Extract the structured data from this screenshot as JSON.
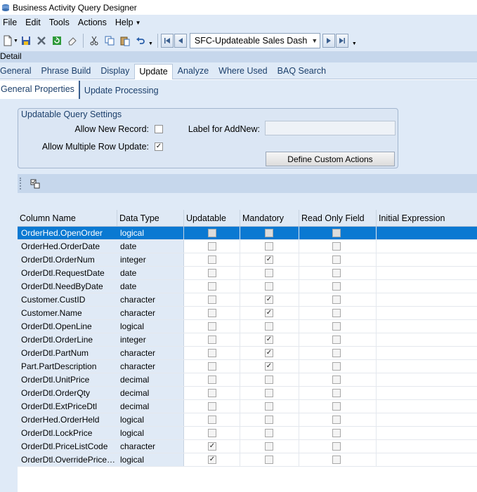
{
  "window": {
    "title": "Business Activity Query Designer"
  },
  "menu": [
    {
      "label": "File"
    },
    {
      "label": "Edit"
    },
    {
      "label": "Tools"
    },
    {
      "label": "Actions"
    },
    {
      "label": "Help"
    }
  ],
  "toolbar": {
    "query_select": "SFC-Updateable Sales Dash"
  },
  "section": {
    "label": "Detail"
  },
  "tabs": [
    {
      "label": "General"
    },
    {
      "label": "Phrase Build"
    },
    {
      "label": "Display"
    },
    {
      "label": "Update"
    },
    {
      "label": "Analyze"
    },
    {
      "label": "Where Used"
    },
    {
      "label": "BAQ Search"
    }
  ],
  "subtabs": [
    {
      "label": "General Properties"
    },
    {
      "label": "Update  Processing"
    }
  ],
  "settings": {
    "group_title": "Updatable Query Settings",
    "allow_new_record_label": "Allow New Record:",
    "allow_new_record_checked": "",
    "label_for_addnew_label": "Label for AddNew:",
    "label_for_addnew_value": "",
    "allow_multi_update_label": "Allow Multiple Row Update:",
    "allow_multi_update_checked": "✓",
    "define_actions_label": "Define Custom Actions"
  },
  "grid": {
    "headers": [
      "Column Name",
      "Data Type",
      "Updatable",
      "Mandatory",
      "Read Only Field",
      "Initial Expression"
    ],
    "rows": [
      {
        "name": "OrderHed.OpenOrder",
        "type": "logical",
        "updatable": "",
        "mandatory": "",
        "readonly": "",
        "initial": ""
      },
      {
        "name": "OrderHed.OrderDate",
        "type": "date",
        "updatable": "",
        "mandatory": "",
        "readonly": "",
        "initial": ""
      },
      {
        "name": "OrderDtl.OrderNum",
        "type": "integer",
        "updatable": "",
        "mandatory": "✓",
        "readonly": "",
        "initial": ""
      },
      {
        "name": "OrderDtl.RequestDate",
        "type": "date",
        "updatable": "",
        "mandatory": "",
        "readonly": "",
        "initial": ""
      },
      {
        "name": "OrderDtl.NeedByDate",
        "type": "date",
        "updatable": "",
        "mandatory": "",
        "readonly": "",
        "initial": ""
      },
      {
        "name": "Customer.CustID",
        "type": "character",
        "updatable": "",
        "mandatory": "✓",
        "readonly": "",
        "initial": ""
      },
      {
        "name": "Customer.Name",
        "type": "character",
        "updatable": "",
        "mandatory": "✓",
        "readonly": "",
        "initial": ""
      },
      {
        "name": "OrderDtl.OpenLine",
        "type": "logical",
        "updatable": "",
        "mandatory": "",
        "readonly": "",
        "initial": ""
      },
      {
        "name": "OrderDtl.OrderLine",
        "type": "integer",
        "updatable": "",
        "mandatory": "✓",
        "readonly": "",
        "initial": ""
      },
      {
        "name": "OrderDtl.PartNum",
        "type": "character",
        "updatable": "",
        "mandatory": "✓",
        "readonly": "",
        "initial": ""
      },
      {
        "name": "Part.PartDescription",
        "type": "character",
        "updatable": "",
        "mandatory": "✓",
        "readonly": "",
        "initial": ""
      },
      {
        "name": "OrderDtl.UnitPrice",
        "type": "decimal",
        "updatable": "",
        "mandatory": "",
        "readonly": "",
        "initial": ""
      },
      {
        "name": "OrderDtl.OrderQty",
        "type": "decimal",
        "updatable": "",
        "mandatory": "",
        "readonly": "",
        "initial": ""
      },
      {
        "name": "OrderDtl.ExtPriceDtl",
        "type": "decimal",
        "updatable": "",
        "mandatory": "",
        "readonly": "",
        "initial": ""
      },
      {
        "name": "OrderHed.OrderHeld",
        "type": "logical",
        "updatable": "",
        "mandatory": "",
        "readonly": "",
        "initial": ""
      },
      {
        "name": "OrderDtl.LockPrice",
        "type": "logical",
        "updatable": "",
        "mandatory": "",
        "readonly": "",
        "initial": ""
      },
      {
        "name": "OrderDtl.PriceListCode",
        "type": "character",
        "updatable": "✓",
        "mandatory": "",
        "readonly": "",
        "initial": ""
      },
      {
        "name": "OrderDtl.OverridePrice…",
        "type": "logical",
        "updatable": "✓",
        "mandatory": "",
        "readonly": "",
        "initial": ""
      }
    ]
  }
}
